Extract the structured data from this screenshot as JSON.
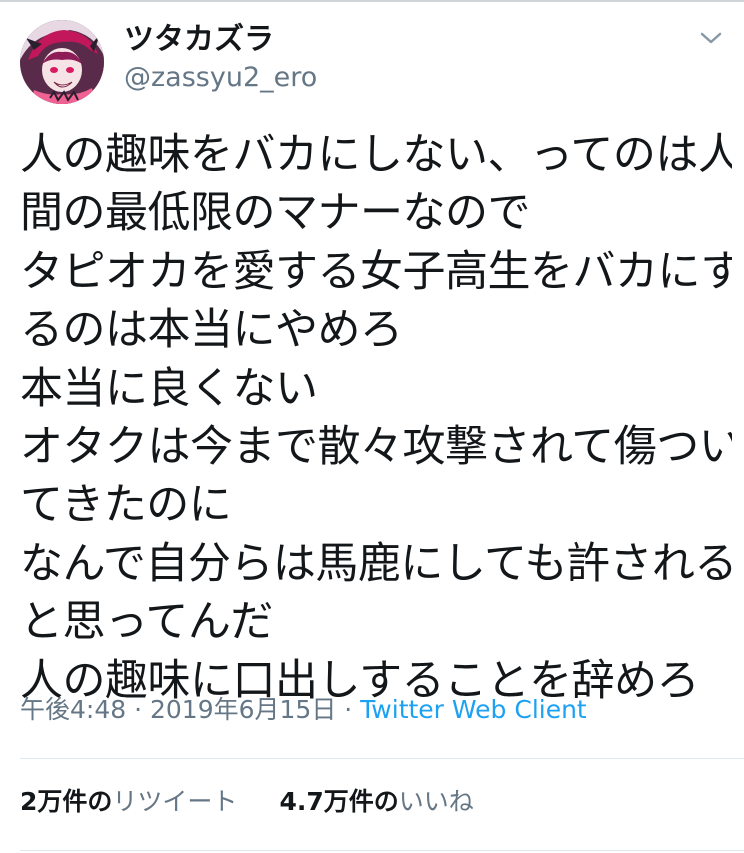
{
  "tweet": {
    "user": {
      "display_name": "ツタカズラ",
      "handle": "@zassyu2_ero"
    },
    "text_lines": [
      "人の趣味をバカにしない、ってのは人",
      "間の最低限のマナーなので",
      "タピオカを愛する女子高生をバカにす",
      "るのは本当にやめろ",
      "本当に良くない",
      "オタクは今まで散々攻撃されて傷つい",
      "てきたのに",
      "なんで自分らは馬鹿にしても許される",
      "と思ってんだ",
      "人の趣味に口出しすることを辞めろ"
    ],
    "meta": {
      "time": "午後4:48",
      "separator": " · ",
      "date": "2019年6月15日",
      "client": "Twitter Web Client"
    },
    "stats": {
      "retweets_count": "2万",
      "retweets_unit": "件の",
      "retweets_label": "リツイート",
      "likes_count": "4.7万",
      "likes_unit": "件の",
      "likes_label": "いいね"
    },
    "icons": {
      "menu": "chevron-down-icon",
      "avatar": "avatar"
    },
    "colors": {
      "text": "#14171a",
      "secondary": "#657786",
      "link": "#1da1f2",
      "divider": "#e1e8ed"
    }
  }
}
